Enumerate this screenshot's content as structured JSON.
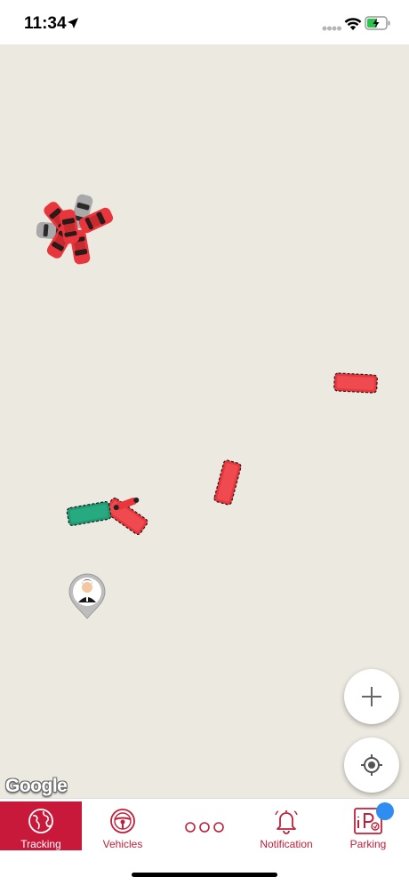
{
  "status_bar": {
    "time": "11:34"
  },
  "map": {
    "provider_logo": "Google",
    "zoom_icon": "plus-icon",
    "locate_icon": "crosshair-icon",
    "colors": {
      "background": "#ece9e1",
      "vehicle_red": "#e8363c",
      "vehicle_green": "#1f9a72",
      "vehicle_gray": "#a9a9a9"
    }
  },
  "tab_bar": {
    "tabs": [
      {
        "label": "Tracking",
        "icon": "globe-icon",
        "active": true
      },
      {
        "label": "Vehicles",
        "icon": "steering-wheel-icon",
        "active": false
      },
      {
        "label": "",
        "icon": "more-dots-icon",
        "active": false
      },
      {
        "label": "Notification",
        "icon": "bell-icon",
        "active": false
      },
      {
        "label": "Parking",
        "icon": "parking-icon",
        "active": false
      }
    ],
    "accent_color": "#c8193a"
  }
}
